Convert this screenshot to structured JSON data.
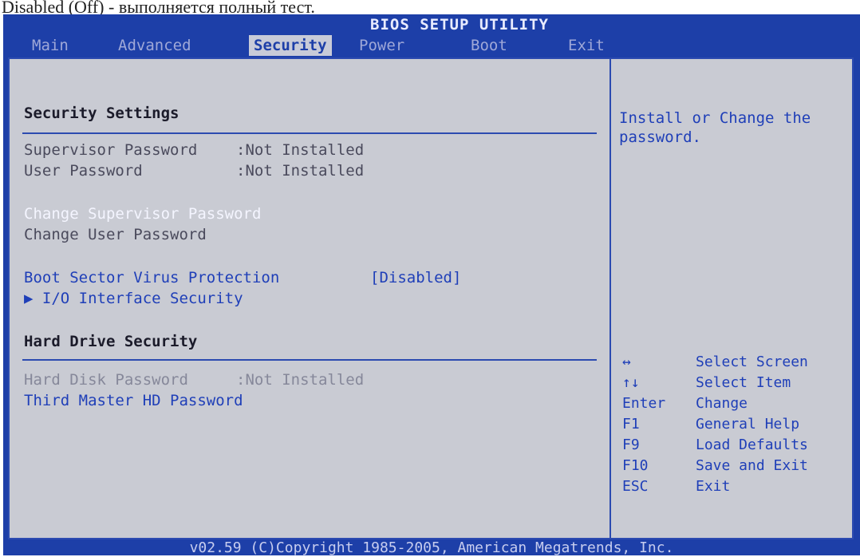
{
  "caption": "Disabled (Off) - выполняется полный тест.",
  "title": "BIOS SETUP UTILITY",
  "menu": [
    "Main",
    "Advanced",
    "Security",
    "Power",
    "Boot",
    "Exit"
  ],
  "active_menu": "Security",
  "main": {
    "security_heading": "Security Settings",
    "supervisor_password": {
      "label": "Supervisor Password",
      "value": ":Not Installed"
    },
    "user_password": {
      "label": "User Password",
      "value": ":Not Installed"
    },
    "change_supervisor": "Change Supervisor Password",
    "change_user": "Change User Password",
    "boot_sector": {
      "label": "Boot Sector Virus Protection",
      "value": "[Disabled]"
    },
    "io_security": "I/O Interface Security",
    "hard_drive_heading": "Hard Drive Security",
    "hard_disk_password": {
      "label": "Hard Disk Password",
      "value": ":Not Installed"
    },
    "third_master": "Third Master HD Password"
  },
  "help": {
    "text_line1": "Install or Change the",
    "text_line2": "password.",
    "keys": [
      {
        "key": "↔",
        "action": "Select Screen"
      },
      {
        "key": "↑↓",
        "action": "Select Item"
      },
      {
        "key": "Enter",
        "action": "Change"
      },
      {
        "key": "F1",
        "action": "General Help"
      },
      {
        "key": "F9",
        "action": "Load Defaults"
      },
      {
        "key": "F10",
        "action": "Save and Exit"
      },
      {
        "key": "ESC",
        "action": "Exit"
      }
    ]
  },
  "footer": "v02.59 (C)Copyright 1985-2005, American Megatrends, Inc."
}
